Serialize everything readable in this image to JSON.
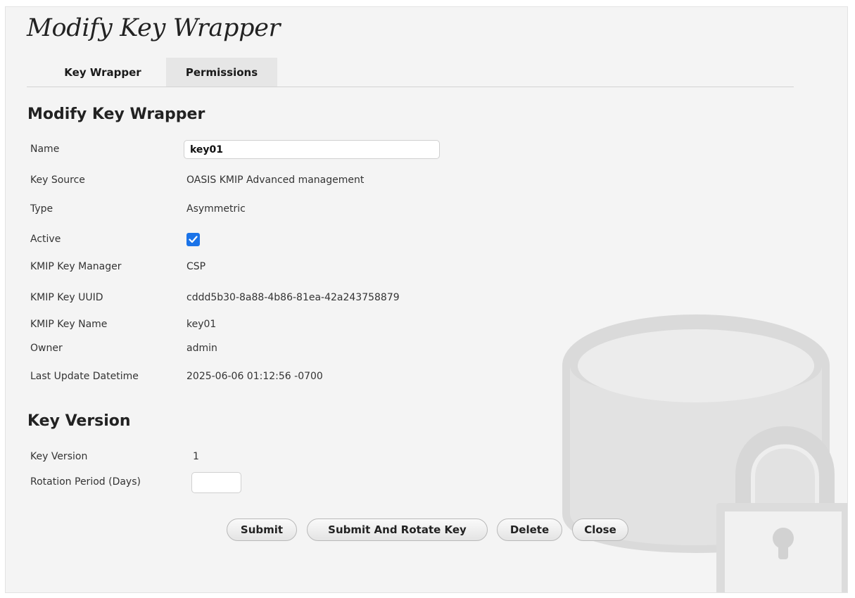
{
  "page": {
    "title": "Modify Key Wrapper"
  },
  "tabs": [
    {
      "label": "Key Wrapper",
      "active": true
    },
    {
      "label": "Permissions",
      "active": false
    }
  ],
  "key_wrapper": {
    "section_title": "Modify Key Wrapper",
    "name": {
      "label": "Name",
      "value": "key01"
    },
    "key_source": {
      "label": "Key Source",
      "value": "OASIS KMIP Advanced management"
    },
    "type": {
      "label": "Type",
      "value": "Asymmetric"
    },
    "active": {
      "label": "Active",
      "checked": true
    },
    "kmip_key_manager": {
      "label": "KMIP Key Manager",
      "value": "CSP"
    },
    "kmip_key_uuid": {
      "label": "KMIP Key UUID",
      "value": "cddd5b30-8a88-4b86-81ea-42a243758879"
    },
    "kmip_key_name": {
      "label": "KMIP Key Name",
      "value": "key01"
    },
    "owner": {
      "label": "Owner",
      "value": "admin"
    },
    "last_update": {
      "label": "Last Update Datetime",
      "value": "2025-06-06 01:12:56 -0700"
    }
  },
  "key_version": {
    "section_title": "Key Version",
    "version": {
      "label": "Key Version",
      "value": "1"
    },
    "rotation_period": {
      "label": "Rotation Period (Days)",
      "value": ""
    }
  },
  "actions": {
    "submit": "Submit",
    "submit_rotate": "Submit And Rotate Key",
    "delete": "Delete",
    "close": "Close"
  },
  "colors": {
    "checkbox": "#1a73e8",
    "panel_bg": "#f4f4f4",
    "background_icon": "#d9d9d9"
  },
  "icons": {
    "background": "database-lock-icon",
    "checkbox": "checkmark-icon"
  }
}
